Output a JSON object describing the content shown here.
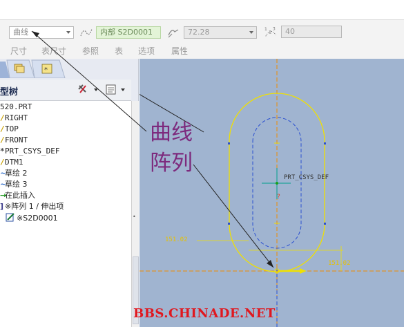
{
  "dashboard": {
    "reference_type": "曲线",
    "sketch_ref": "内部 S2D0001",
    "depth_value": "72.28",
    "count_value": "40",
    "tabs": [
      "尺寸",
      "表尺寸",
      "参照",
      "表",
      "选项",
      "属性"
    ]
  },
  "model_tree": {
    "title": "型树",
    "items": [
      {
        "label": "520.PRT",
        "mark": ""
      },
      {
        "label": "RIGHT",
        "mark": "/"
      },
      {
        "label": "TOP",
        "mark": "/"
      },
      {
        "label": "FRONT",
        "mark": "/"
      },
      {
        "label": "PRT_CSYS_DEF",
        "mark": "*"
      },
      {
        "label": "DTM1",
        "mark": "/"
      },
      {
        "label": "草绘 2",
        "mark": ""
      },
      {
        "label": "草绘 3",
        "mark": ""
      },
      {
        "label": "在此插入",
        "mark": "→"
      },
      {
        "label": "※阵列 1 / 伸出项",
        "mark": ""
      },
      {
        "label": "※S2D0001",
        "mark": ""
      }
    ]
  },
  "graphics": {
    "csys_label": "PRT_CSYS_DEF",
    "dim_left": "151.02",
    "dim_right": "151.02"
  },
  "annotation": {
    "line1": "曲线",
    "line2": "阵列"
  },
  "watermark": "BBS.CHINADE.NET",
  "colors": {
    "graphics_bg": "#a0b4d0",
    "curve": "#f0e000",
    "datum_axis": "#f08c00",
    "hidden_curve": "#2a4fd0",
    "annotation_text": "#7d2a7d",
    "watermark": "#e0181f"
  }
}
